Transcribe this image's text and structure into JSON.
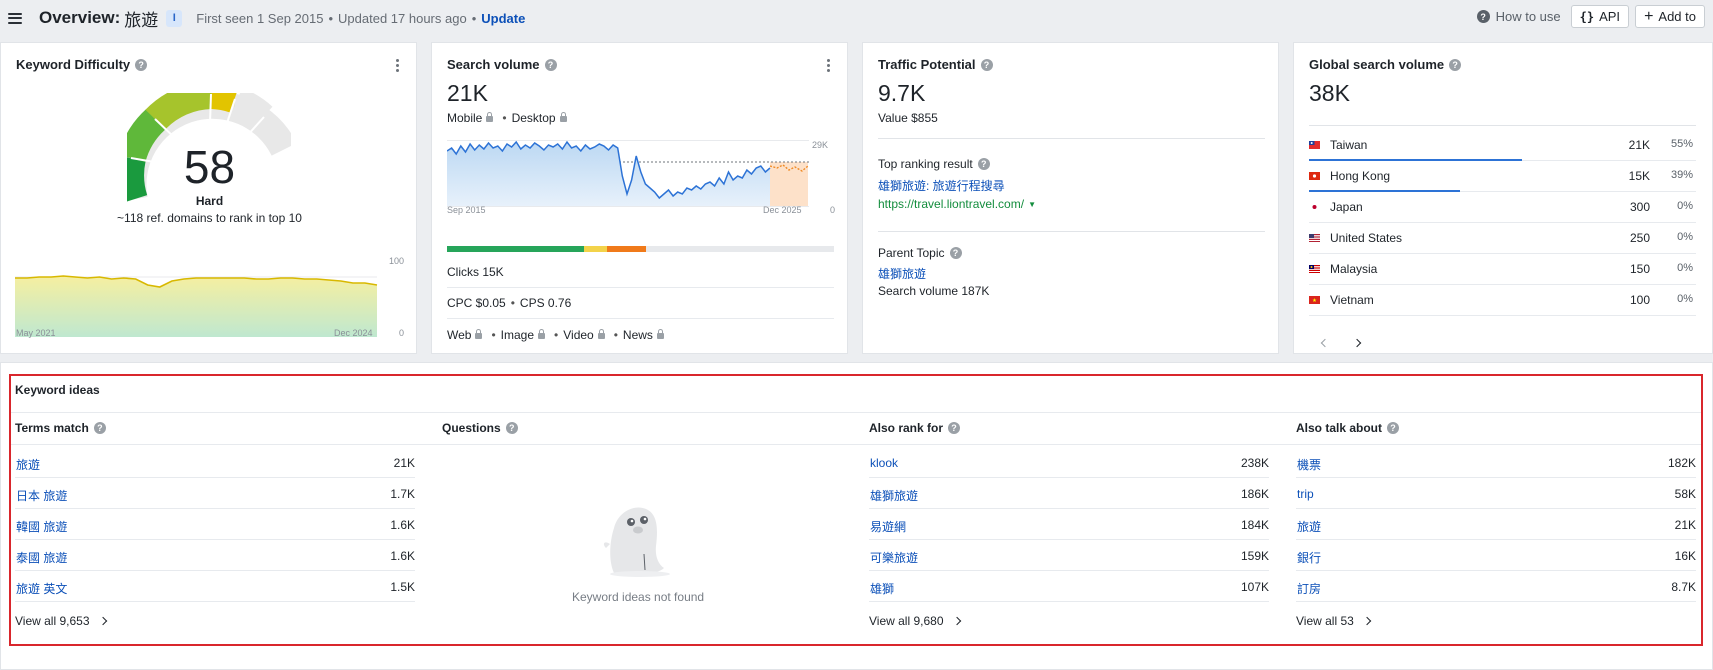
{
  "header": {
    "title": "Overview:",
    "keyword": "旅遊",
    "badge": "I",
    "first_seen": "First seen 1 Sep 2015",
    "updated": "Updated 17 hours ago",
    "update_link": "Update",
    "how_to_use": "How to use",
    "api_label": "API",
    "add_to_label": "Add to"
  },
  "kd": {
    "title": "Keyword Difficulty",
    "value": "58",
    "label": "Hard",
    "subtitle": "~118 ref. domains to rank in top 10",
    "axis_max": "100",
    "axis_min": "0",
    "x_start": "May 2021",
    "x_end": "Dec 2024",
    "gauge_fraction": 0.58
  },
  "sv": {
    "title": "Search volume",
    "value": "21K",
    "mobile": "Mobile",
    "desktop": "Desktop",
    "axis_max": "29K",
    "axis_min": "0",
    "x_start": "Sep 2015",
    "x_end": "Dec 2025",
    "clicks": "Clicks 15K",
    "cpc": "CPC $0.05",
    "cps": "CPS 0.76",
    "serp_types": [
      "Web",
      "Image",
      "Video",
      "News"
    ]
  },
  "tp": {
    "title": "Traffic Potential",
    "value": "9.7K",
    "value_label": "Value $855",
    "top_ranking_label": "Top ranking result",
    "top_ranking_title": "雄獅旅遊: 旅遊行程搜尋",
    "top_ranking_url": "https://travel.liontravel.com/",
    "parent_topic_label": "Parent Topic",
    "parent_topic": "雄獅旅遊",
    "parent_volume": "Search volume 187K"
  },
  "gsv": {
    "title": "Global search volume",
    "value": "38K",
    "countries": [
      {
        "name": "Taiwan",
        "volume": "21K",
        "pct": "55%",
        "share": 0.55
      },
      {
        "name": "Hong Kong",
        "volume": "15K",
        "pct": "39%",
        "share": 0.39
      },
      {
        "name": "Japan",
        "volume": "300",
        "pct": "0%",
        "share": 0
      },
      {
        "name": "United States",
        "volume": "250",
        "pct": "0%",
        "share": 0
      },
      {
        "name": "Malaysia",
        "volume": "150",
        "pct": "0%",
        "share": 0
      },
      {
        "name": "Vietnam",
        "volume": "100",
        "pct": "0%",
        "share": 0
      }
    ]
  },
  "ideas": {
    "title": "Keyword ideas",
    "terms_match": {
      "title": "Terms match",
      "rows": [
        {
          "kw": "旅遊",
          "vol": "21K"
        },
        {
          "kw": "日本 旅遊",
          "vol": "1.7K"
        },
        {
          "kw": "韓國 旅遊",
          "vol": "1.6K"
        },
        {
          "kw": "泰國 旅遊",
          "vol": "1.6K"
        },
        {
          "kw": "旅遊 英文",
          "vol": "1.5K"
        }
      ],
      "view_all": "View all 9,653"
    },
    "questions": {
      "title": "Questions",
      "empty": "Keyword ideas not found"
    },
    "also_rank": {
      "title": "Also rank for",
      "rows": [
        {
          "kw": "klook",
          "vol": "238K"
        },
        {
          "kw": "雄獅旅遊",
          "vol": "186K"
        },
        {
          "kw": "易遊網",
          "vol": "184K"
        },
        {
          "kw": "可樂旅遊",
          "vol": "159K"
        },
        {
          "kw": "雄獅",
          "vol": "107K"
        }
      ],
      "view_all": "View all 9,680"
    },
    "also_talk": {
      "title": "Also talk about",
      "rows": [
        {
          "kw": "機票",
          "vol": "182K"
        },
        {
          "kw": "trip",
          "vol": "58K"
        },
        {
          "kw": "旅遊",
          "vol": "21K"
        },
        {
          "kw": "銀行",
          "vol": "16K"
        },
        {
          "kw": "訂房",
          "vol": "8.7K"
        }
      ],
      "view_all": "View all 53"
    }
  }
}
